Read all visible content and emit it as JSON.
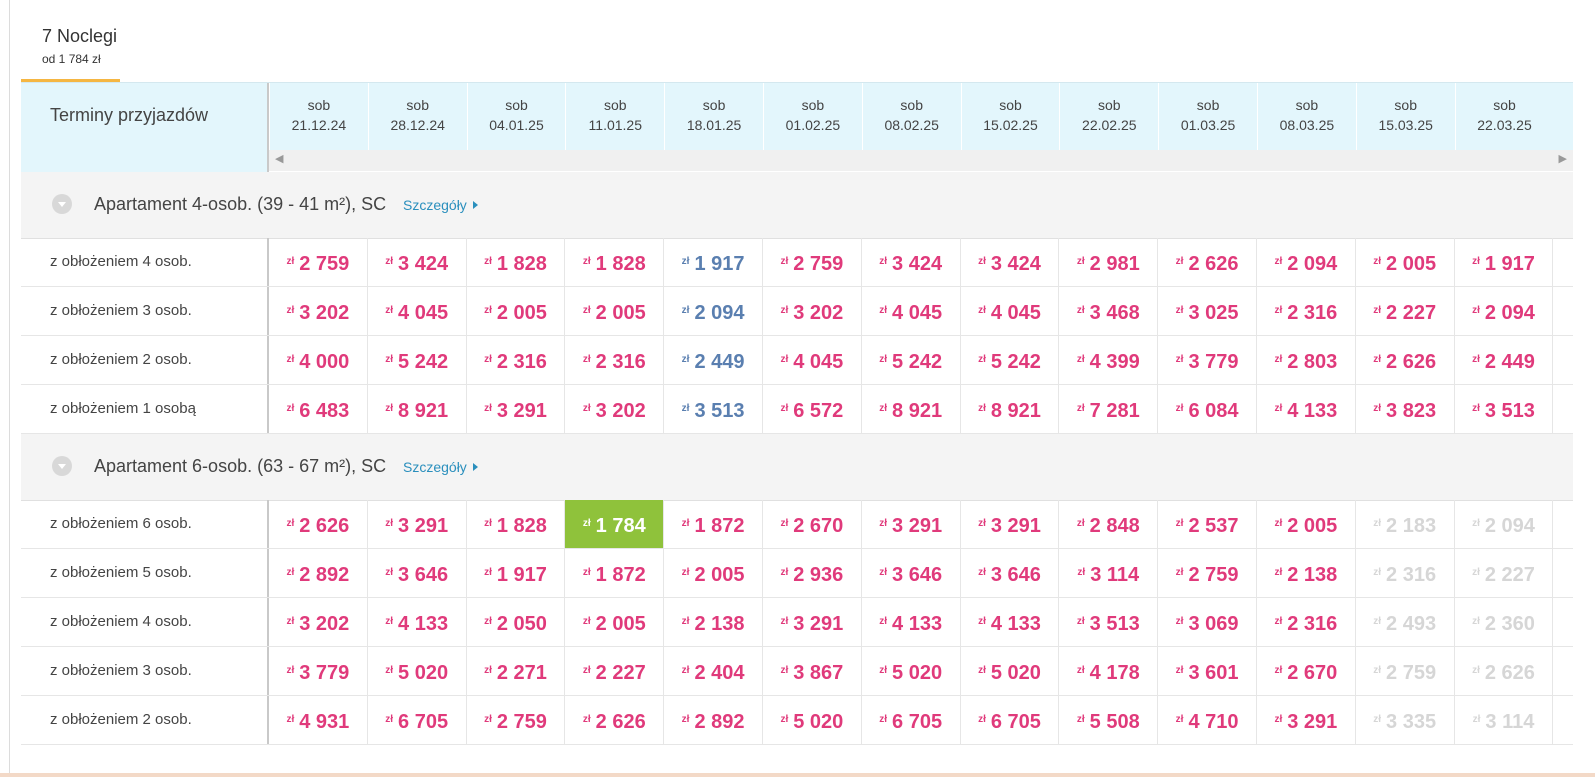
{
  "tab": {
    "title": "7 Noclegi",
    "subtitle": "od 1 784 zł"
  },
  "header": {
    "label": "Terminy przyjazdów",
    "dates": [
      {
        "day": "sob",
        "date": "21.12.24"
      },
      {
        "day": "sob",
        "date": "28.12.24"
      },
      {
        "day": "sob",
        "date": "04.01.25"
      },
      {
        "day": "sob",
        "date": "11.01.25"
      },
      {
        "day": "sob",
        "date": "18.01.25"
      },
      {
        "day": "sob",
        "date": "01.02.25"
      },
      {
        "day": "sob",
        "date": "08.02.25"
      },
      {
        "day": "sob",
        "date": "15.02.25"
      },
      {
        "day": "sob",
        "date": "22.02.25"
      },
      {
        "day": "sob",
        "date": "01.03.25"
      },
      {
        "day": "sob",
        "date": "08.03.25"
      },
      {
        "day": "sob",
        "date": "15.03.25"
      },
      {
        "day": "sob",
        "date": "22.03.25"
      }
    ]
  },
  "currency": "zł",
  "colors": {
    "price": "#e03a7b",
    "blue": "#5a7fb0",
    "unavailable": "#d6d6d6",
    "best": "#8fc23b",
    "link": "#2a8fbd"
  },
  "sections": [
    {
      "title": "Apartament 4-osob. (39 - 41 m²), SC",
      "link": "Szczegóły",
      "rows": [
        {
          "label": "z obłożeniem 4 osob.",
          "prices": [
            "2 759",
            "3 424",
            "1 828",
            "1 828",
            "1 917",
            "2 759",
            "3 424",
            "3 424",
            "2 981",
            "2 626",
            "2 094",
            "2 005",
            "1 917"
          ],
          "styles": [
            "p",
            "p",
            "p",
            "p",
            "b",
            "p",
            "p",
            "p",
            "p",
            "p",
            "p",
            "p",
            "p"
          ]
        },
        {
          "label": "z obłożeniem 3 osob.",
          "prices": [
            "3 202",
            "4 045",
            "2 005",
            "2 005",
            "2 094",
            "3 202",
            "4 045",
            "4 045",
            "3 468",
            "3 025",
            "2 316",
            "2 227",
            "2 094"
          ],
          "styles": [
            "p",
            "p",
            "p",
            "p",
            "b",
            "p",
            "p",
            "p",
            "p",
            "p",
            "p",
            "p",
            "p"
          ]
        },
        {
          "label": "z obłożeniem 2 osob.",
          "prices": [
            "4 000",
            "5 242",
            "2 316",
            "2 316",
            "2 449",
            "4 045",
            "5 242",
            "5 242",
            "4 399",
            "3 779",
            "2 803",
            "2 626",
            "2 449"
          ],
          "styles": [
            "p",
            "p",
            "p",
            "p",
            "b",
            "p",
            "p",
            "p",
            "p",
            "p",
            "p",
            "p",
            "p"
          ]
        },
        {
          "label": "z obłożeniem 1 osobą",
          "prices": [
            "6 483",
            "8 921",
            "3 291",
            "3 202",
            "3 513",
            "6 572",
            "8 921",
            "8 921",
            "7 281",
            "6 084",
            "4 133",
            "3 823",
            "3 513"
          ],
          "styles": [
            "p",
            "p",
            "p",
            "p",
            "b",
            "p",
            "p",
            "p",
            "p",
            "p",
            "p",
            "p",
            "p"
          ]
        }
      ]
    },
    {
      "title": "Apartament 6-osob. (63 - 67 m²), SC",
      "link": "Szczegóły",
      "rows": [
        {
          "label": "z obłożeniem 6 osob.",
          "prices": [
            "2 626",
            "3 291",
            "1 828",
            "1 784",
            "1 872",
            "2 670",
            "3 291",
            "3 291",
            "2 848",
            "2 537",
            "2 005",
            "2 183",
            "2 094"
          ],
          "styles": [
            "p",
            "p",
            "p",
            "best",
            "p",
            "p",
            "p",
            "p",
            "p",
            "p",
            "p",
            "g",
            "g"
          ]
        },
        {
          "label": "z obłożeniem 5 osob.",
          "prices": [
            "2 892",
            "3 646",
            "1 917",
            "1 872",
            "2 005",
            "2 936",
            "3 646",
            "3 646",
            "3 114",
            "2 759",
            "2 138",
            "2 316",
            "2 227"
          ],
          "styles": [
            "p",
            "p",
            "p",
            "p",
            "p",
            "p",
            "p",
            "p",
            "p",
            "p",
            "p",
            "g",
            "g"
          ]
        },
        {
          "label": "z obłożeniem 4 osob.",
          "prices": [
            "3 202",
            "4 133",
            "2 050",
            "2 005",
            "2 138",
            "3 291",
            "4 133",
            "4 133",
            "3 513",
            "3 069",
            "2 316",
            "2 493",
            "2 360"
          ],
          "styles": [
            "p",
            "p",
            "p",
            "p",
            "p",
            "p",
            "p",
            "p",
            "p",
            "p",
            "p",
            "g",
            "g"
          ]
        },
        {
          "label": "z obłożeniem 3 osob.",
          "prices": [
            "3 779",
            "5 020",
            "2 271",
            "2 227",
            "2 404",
            "3 867",
            "5 020",
            "5 020",
            "4 178",
            "3 601",
            "2 670",
            "2 759",
            "2 626"
          ],
          "styles": [
            "p",
            "p",
            "p",
            "p",
            "p",
            "p",
            "p",
            "p",
            "p",
            "p",
            "p",
            "g",
            "g"
          ]
        },
        {
          "label": "z obłożeniem 2 osob.",
          "prices": [
            "4 931",
            "6 705",
            "2 759",
            "2 626",
            "2 892",
            "5 020",
            "6 705",
            "6 705",
            "5 508",
            "4 710",
            "3 291",
            "3 335",
            "3 114"
          ],
          "styles": [
            "p",
            "p",
            "p",
            "p",
            "p",
            "p",
            "p",
            "p",
            "p",
            "p",
            "p",
            "g",
            "g"
          ]
        }
      ]
    }
  ]
}
